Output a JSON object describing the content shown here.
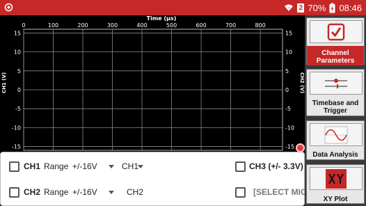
{
  "status_bar": {
    "battery_percent": "70%",
    "time": "08:46",
    "sim_slot": "2",
    "icons": [
      "notification-icon",
      "wifi-icon",
      "sim-icon",
      "battery-charging-icon"
    ],
    "color": "#c62828"
  },
  "plot": {
    "x_axis_title": "Time (µs)",
    "x_ticks": [
      "0",
      "100",
      "200",
      "300",
      "400",
      "500",
      "600",
      "700",
      "800"
    ],
    "y_ticks": [
      "15",
      "10",
      "5",
      "0",
      "-5",
      "-10",
      "-15"
    ],
    "left_axis_label": "CH1 (V)",
    "right_axis_label": "CH2 (V)",
    "y_range": [
      -16,
      16
    ],
    "x_range": [
      0,
      875
    ],
    "grid": true
  },
  "controls": {
    "row1": {
      "channel": "CH1",
      "range_label": "Range",
      "range_value": "+/-16V",
      "source_value": "CH1",
      "extra_checkbox_label": "CH3 (+/- 3.3V)"
    },
    "row2": {
      "channel": "CH2",
      "range_label": "Range",
      "range_value": "+/-16V",
      "source_value": "CH2",
      "extra_checkbox_label": "[SELECT MIC]"
    }
  },
  "sidebar": {
    "items": [
      {
        "label": "Channel Parameters",
        "icon": "checkbox-checked-icon",
        "active": true
      },
      {
        "label": "Timebase and Trigger",
        "icon": "timebase-sliders-icon",
        "active": false
      },
      {
        "label": "Data Analysis",
        "icon": "sine-wave-icon",
        "active": false
      },
      {
        "label": "XY Plot",
        "icon": "xy-plot-icon",
        "active": false
      }
    ],
    "accent": "#c62828"
  }
}
